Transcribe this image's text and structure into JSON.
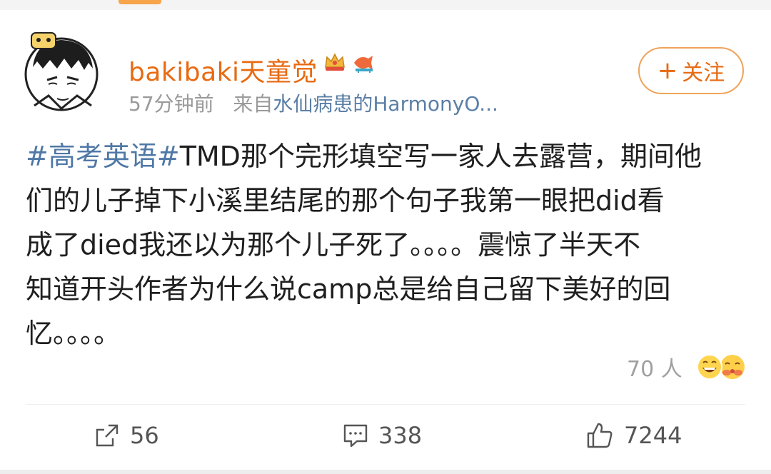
{
  "post": {
    "username": "bakibaki天童觉",
    "time": "57分钟前",
    "source_prefix": "来自",
    "source": "水仙病患的HarmonyO...",
    "follow_label": "关注",
    "hashtag": "#高考英语#",
    "lines": [
      "TMD那个完形填空写一家人去露营，期间他",
      "们的儿子掉下小溪里结尾的那个句子我第一眼把did看",
      "成了died我还以为那个儿子死了。。。。震惊了半天不",
      "知道开头作者为什么说camp总是给自己留下美好的回",
      "忆。。。。"
    ],
    "reaction_count": "70 人"
  },
  "actions": {
    "repost_count": "56",
    "comment_count": "338",
    "like_count": "7244"
  },
  "icons": {
    "follow": "plus-icon",
    "repost": "share-icon",
    "comment": "comment-icon",
    "like": "thumbs-up-icon",
    "badge1": "crown-badge-icon",
    "badge2": "fish-badge-icon",
    "reaction1": "grin-emoji-icon",
    "reaction2": "hug-emoji-icon"
  },
  "colors": {
    "username": "#e86a12",
    "hashtag": "#4f78a6",
    "source": "#5b7fa6",
    "meta": "#9a9a9a"
  }
}
